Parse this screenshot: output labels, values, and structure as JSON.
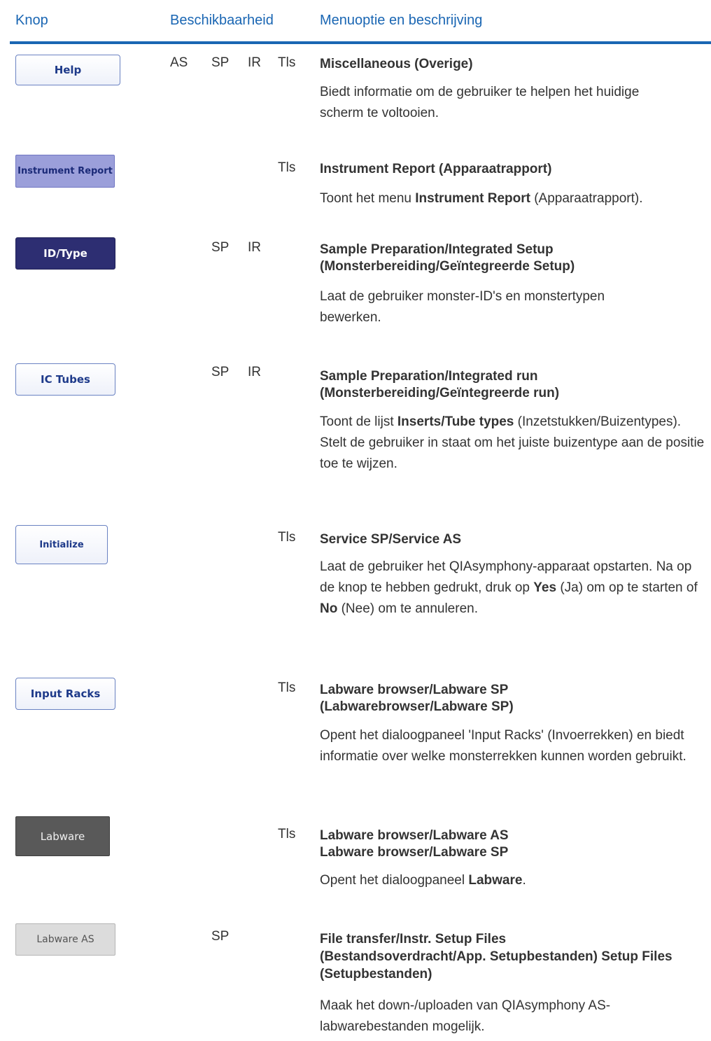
{
  "headers": {
    "knop": "Knop",
    "beschikbaarheid": "Beschikbaarheid",
    "menu": "Menuoptie en beschrijving"
  },
  "rows": [
    {
      "button": "Help",
      "avail": {
        "as": "AS",
        "sp": "SP",
        "ir": "IR",
        "tls": "Tls"
      },
      "title_1": "Miscellaneous (Overige)",
      "desc": {
        "t1": "Biedt informatie om de gebruiker te helpen het huidige scherm te voltooien."
      }
    },
    {
      "button": "Instrument Report",
      "avail": {
        "tls": "Tls"
      },
      "title_1": "Instrument Report (Apparaatrapport)",
      "desc": {
        "t1": "Toont het menu ",
        "b1": "Instrument Report",
        "t2": " (Apparaatrapport)."
      }
    },
    {
      "button": "ID/Type",
      "avail": {
        "sp": "SP",
        "ir": "IR"
      },
      "title_1": "Sample Preparation/Integrated Setup",
      "title_2": "(Monsterbereiding/Geïntegreerde Setup)",
      "desc": {
        "t1": "Laat de gebruiker monster-ID's en monstertypen bewerken."
      }
    },
    {
      "button": "IC Tubes",
      "avail": {
        "sp": "SP",
        "ir": "IR"
      },
      "title_1": "Sample Preparation/Integrated run",
      "title_2": "(Monsterbereiding/Geïntegreerde run)",
      "desc": {
        "t1": "Toont de lijst ",
        "b1": "Inserts/Tube types",
        "t2": " (Inzetstukken/Buizentypes). Stelt de gebruiker in staat om het juiste buizentype aan de positie toe te wijzen."
      }
    },
    {
      "button": "Initialize",
      "avail": {
        "tls": "Tls"
      },
      "title_1": "Service SP/Service AS",
      "desc": {
        "t1": "Laat de gebruiker het QIAsymphony-apparaat opstarten. Na op de knop te hebben gedrukt, druk op ",
        "b1": "Yes",
        "t2": " (Ja) om op te starten of ",
        "b2": "No",
        "t3": " (Nee) om te annuleren."
      }
    },
    {
      "button": "Input Racks",
      "avail": {
        "tls": "Tls"
      },
      "title_1": "Labware browser/Labware SP",
      "title_2": "(Labwarebrowser/Labware SP)",
      "desc": {
        "t1": "Opent het dialoogpaneel 'Input Racks' (Invoerrekken) en biedt informatie over welke monsterrekken kunnen worden gebruikt."
      }
    },
    {
      "button": "Labware",
      "avail": {
        "tls": "Tls"
      },
      "title_1": "Labware browser/Labware AS",
      "title_2": "Labware browser/Labware SP",
      "desc": {
        "t1": "Opent het dialoogpaneel ",
        "b1": "Labware",
        "t2": "."
      }
    },
    {
      "button": "Labware AS",
      "avail": {
        "sp": "SP"
      },
      "title_1": "File transfer/Instr. Setup Files",
      "title_2": "(Bestandsoverdracht/App. Setupbestanden) Setup Files (Setupbestanden)",
      "desc": {
        "t1": "Maak het down-/uploaden van QIAsymphony AS-labwarebestanden mogelijk."
      }
    }
  ],
  "colors": {
    "accent": "#1a66b3",
    "text": "#333333"
  }
}
